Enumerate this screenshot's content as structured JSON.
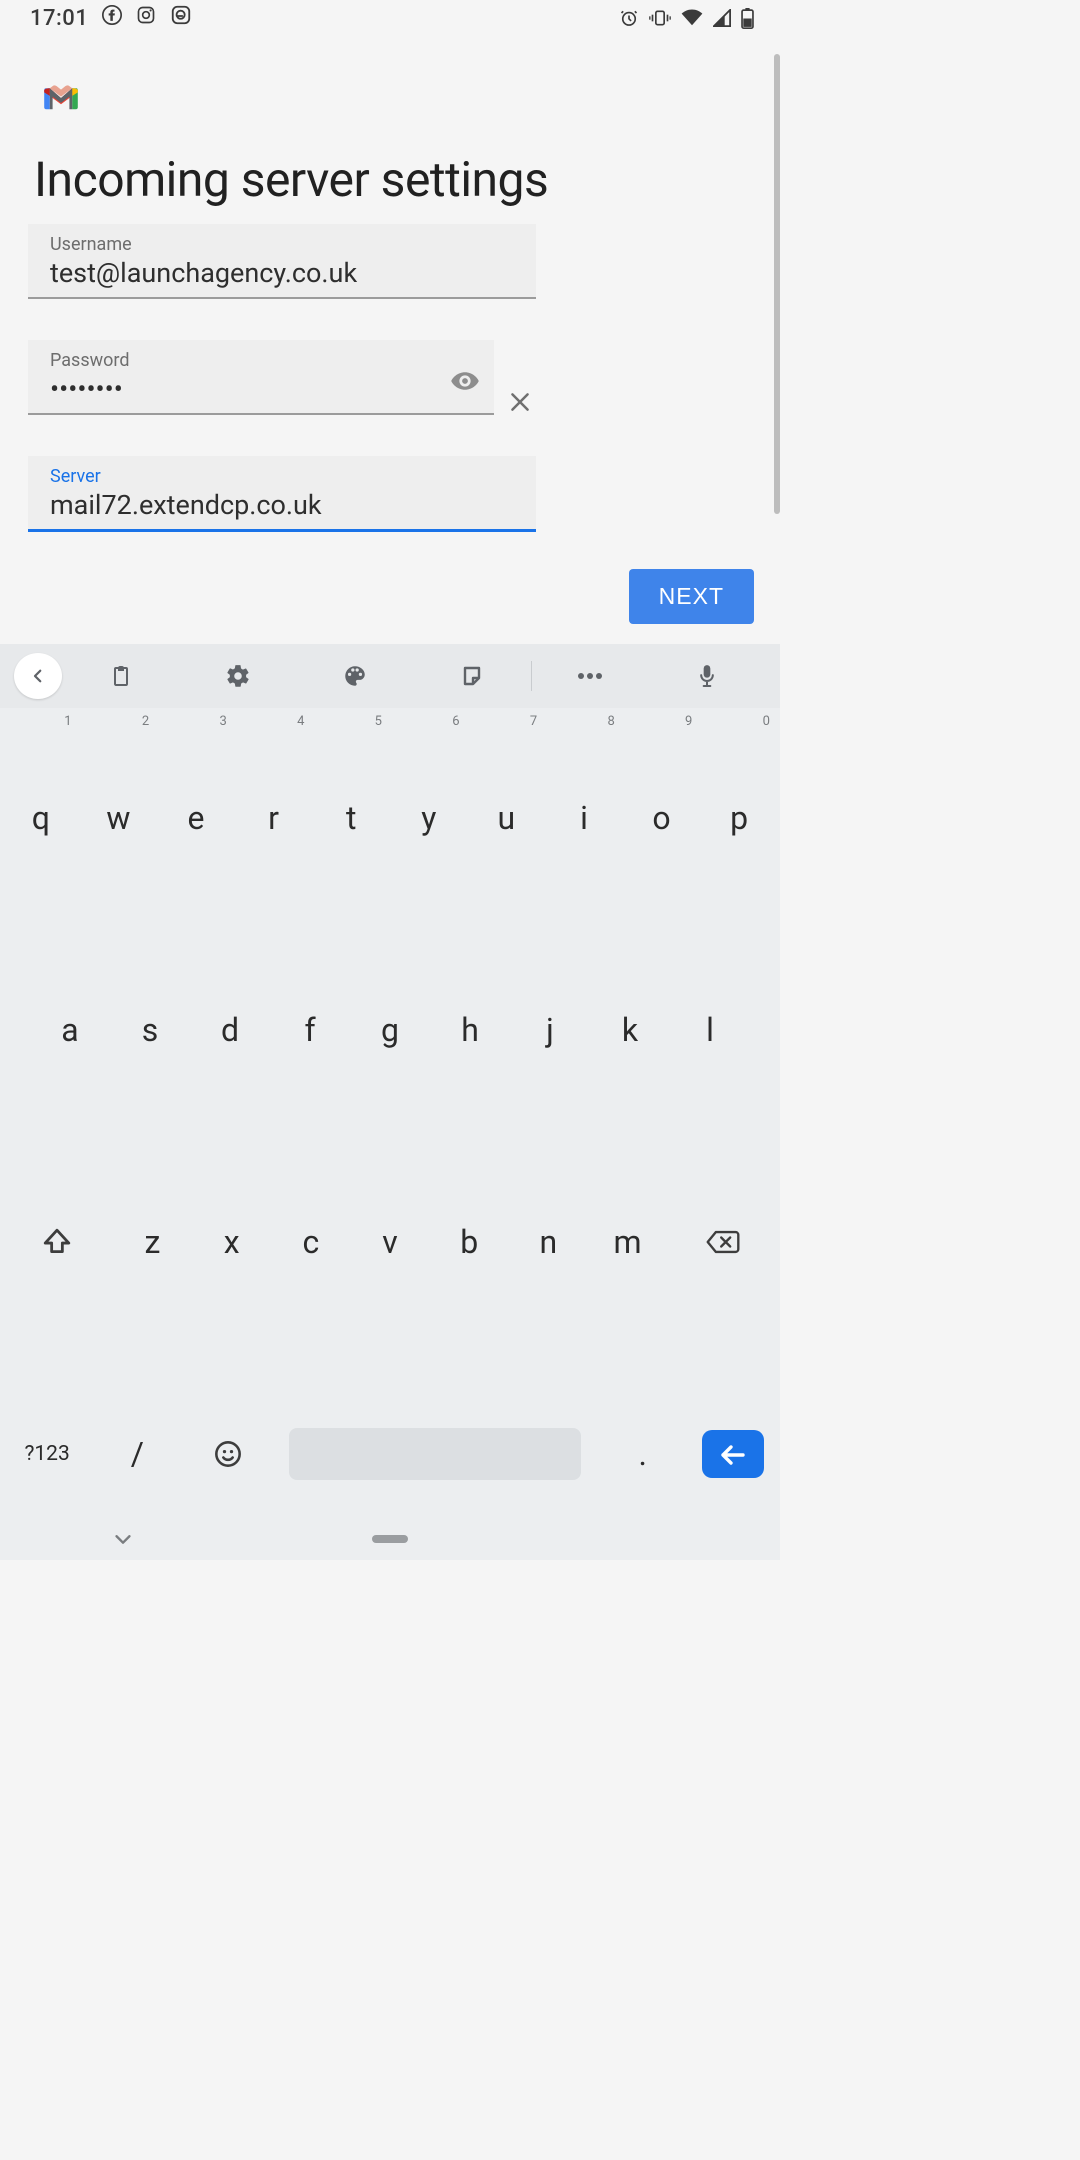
{
  "status": {
    "time": "17:01",
    "left_icons": [
      "facebook-icon",
      "instagram-icon",
      "epost-icon"
    ],
    "right_icons": [
      "alarm-icon",
      "vibrate-icon",
      "wifi-icon",
      "signal-icon",
      "battery-icon"
    ]
  },
  "app": {
    "title": "Incoming server settings",
    "fields": {
      "username": {
        "label": "Username",
        "value": "test@launchagency.co.uk"
      },
      "password": {
        "label": "Password",
        "value": "••••••••"
      },
      "server": {
        "label": "Server",
        "value": "mail72.extendcp.co.uk"
      }
    },
    "next_label": "NEXT"
  },
  "keyboard": {
    "toolbar_icons": [
      "chevron-left-icon",
      "clipboard-icon",
      "gear-icon",
      "palette-icon",
      "sticker-icon",
      "more-icon",
      "mic-icon"
    ],
    "row1_hints": [
      "1",
      "2",
      "3",
      "4",
      "5",
      "6",
      "7",
      "8",
      "9",
      "0"
    ],
    "row1": [
      "q",
      "w",
      "e",
      "r",
      "t",
      "y",
      "u",
      "i",
      "o",
      "p"
    ],
    "row2": [
      "a",
      "s",
      "d",
      "f",
      "g",
      "h",
      "j",
      "k",
      "l"
    ],
    "row3": [
      "z",
      "x",
      "c",
      "v",
      "b",
      "n",
      "m"
    ],
    "row4": {
      "sym": "?123",
      "slash": "/",
      "dot": "."
    }
  }
}
